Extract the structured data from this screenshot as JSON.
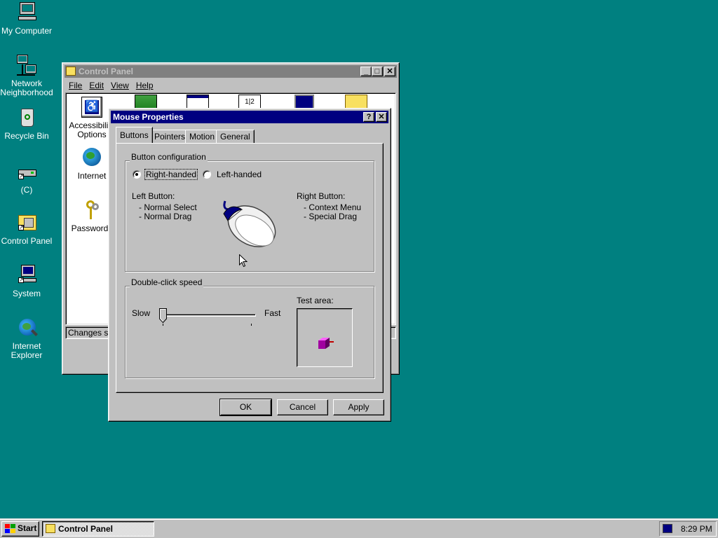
{
  "desktop": {
    "background": "#008080",
    "icons": [
      {
        "label": "My Computer",
        "icon": "computer-icon"
      },
      {
        "label": "Network Neighborhood",
        "icon": "network-icon"
      },
      {
        "label": "Recycle Bin",
        "icon": "recycle-bin-icon"
      },
      {
        "label": "(C)",
        "icon": "drive-shortcut-icon"
      },
      {
        "label": "Control Panel",
        "icon": "control-panel-shortcut-icon"
      },
      {
        "label": "System",
        "icon": "system-shortcut-icon"
      },
      {
        "label": "Internet Explorer",
        "icon": "internet-explorer-icon"
      }
    ]
  },
  "control_panel": {
    "title": "Control Panel",
    "menu": [
      "File",
      "Edit",
      "View",
      "Help"
    ],
    "items": [
      {
        "label": "Accessibility Options",
        "icon": "accessibility-icon"
      },
      {
        "label": "Internet",
        "icon": "internet-globe-icon"
      },
      {
        "label": "Passwords",
        "icon": "keys-icon"
      }
    ],
    "status_text": "Changes set"
  },
  "mouse_properties": {
    "title": "Mouse Properties",
    "help_button": "?",
    "close_button": "✕",
    "tabs": [
      "Buttons",
      "Pointers",
      "Motion",
      "General"
    ],
    "selected_tab": "Buttons",
    "button_config": {
      "group_label": "Button configuration",
      "right_handed": "Right-handed",
      "left_handed": "Left-handed",
      "selected": "Right-handed",
      "left_button_title": "Left Button:",
      "left_button_items": [
        "-  Normal Select",
        "-  Normal Drag"
      ],
      "right_button_title": "Right Button:",
      "right_button_items": [
        "-  Context Menu",
        "-  Special Drag"
      ]
    },
    "double_click": {
      "group_label": "Double-click speed",
      "slow": "Slow",
      "fast": "Fast",
      "slider_position": 0.0,
      "test_area_label": "Test area:"
    },
    "buttons": {
      "ok": "OK",
      "cancel": "Cancel",
      "apply": "Apply"
    }
  },
  "taskbar": {
    "start": "Start",
    "task": "Control Panel",
    "clock": "8:29 PM"
  }
}
